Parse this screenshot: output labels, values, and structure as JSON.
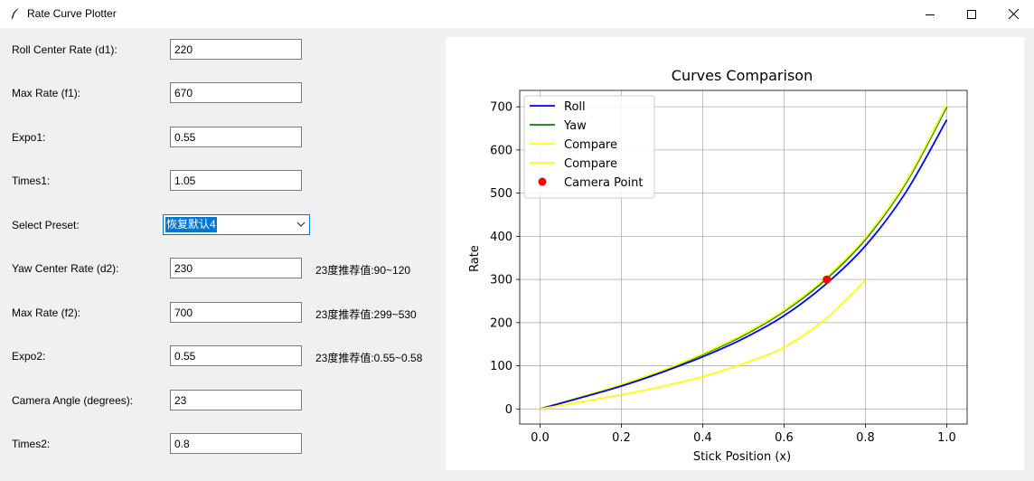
{
  "window": {
    "title": "Rate Curve Plotter",
    "icon": "feather-icon",
    "controls": [
      "minimize-icon",
      "maximize-icon",
      "close-icon"
    ]
  },
  "form": {
    "roll_center_rate": {
      "label": "Roll Center Rate (d1):",
      "value": "220"
    },
    "max_rate_f1": {
      "label": "Max Rate (f1):",
      "value": "670"
    },
    "expo1": {
      "label": "Expo1:",
      "value": "0.55"
    },
    "times1": {
      "label": "Times1:",
      "value": "1.05"
    },
    "preset": {
      "label": "Select Preset:",
      "value": "恢复默认4"
    },
    "yaw_center_rate": {
      "label": "Yaw Center Rate (d2):",
      "value": "230",
      "hint": "23度推荐值:90~120"
    },
    "max_rate_f2": {
      "label": "Max Rate (f2):",
      "value": "700",
      "hint": "23度推荐值:299~530"
    },
    "expo2": {
      "label": "Expo2:",
      "value": "0.55",
      "hint": "23度推荐值:0.55~0.58"
    },
    "camera_angle": {
      "label": "Camera Angle (degrees):",
      "value": "23"
    },
    "times2": {
      "label": "Times2:",
      "value": "0.8"
    }
  },
  "chart_data": {
    "type": "line",
    "title": "Curves Comparison",
    "xlabel": "Stick Position (x)",
    "ylabel": "Rate",
    "xlim": [
      -0.05,
      1.05
    ],
    "ylim": [
      -35,
      738
    ],
    "xticks": [
      "0.0",
      "0.2",
      "0.4",
      "0.6",
      "0.8",
      "1.0"
    ],
    "xtick_values": [
      0,
      0.2,
      0.4,
      0.6,
      0.8,
      1.0
    ],
    "yticks": [
      "0",
      "100",
      "200",
      "300",
      "400",
      "500",
      "600",
      "700"
    ],
    "ytick_values": [
      0,
      100,
      200,
      300,
      400,
      500,
      600,
      700
    ],
    "grid": true,
    "legend_position": "top-left",
    "series": [
      {
        "name": "Roll",
        "color": "#0000ff",
        "x": [
          0,
          0.1,
          0.2,
          0.3,
          0.4,
          0.5,
          0.6,
          0.7,
          0.8,
          0.9,
          1.0
        ],
        "y": [
          0,
          26,
          53,
          85,
          121,
          163,
          216,
          287,
          378,
          503,
          670
        ]
      },
      {
        "name": "Yaw",
        "color": "#008000",
        "x": [
          0,
          0.1,
          0.2,
          0.3,
          0.4,
          0.5,
          0.6,
          0.7,
          0.8,
          0.9,
          1.0
        ],
        "y": [
          0,
          27,
          55,
          88,
          126,
          170,
          226,
          298,
          393,
          524,
          700
        ]
      },
      {
        "name": "Compare",
        "color": "#ffff00",
        "x": [
          0,
          0.1,
          0.2,
          0.3,
          0.4,
          0.5,
          0.6,
          0.7,
          0.8,
          0.9,
          1.0
        ],
        "y": [
          0,
          28,
          57,
          89,
          128,
          173,
          229,
          302,
          397,
          528,
          705
        ]
      },
      {
        "name": "Compare",
        "color": "#ffff00",
        "x": [
          0,
          0.1,
          0.2,
          0.3,
          0.4,
          0.5,
          0.6,
          0.7,
          0.8
        ],
        "y": [
          0,
          16,
          33,
          52,
          75,
          105,
          143,
          207,
          298
        ]
      }
    ],
    "points": [
      {
        "name": "Camera Point",
        "color": "#ff0000",
        "x": 0.705,
        "y": 300
      }
    ]
  }
}
